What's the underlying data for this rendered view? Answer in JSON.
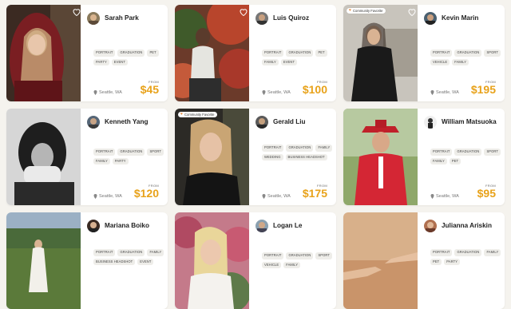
{
  "colors": {
    "price": "#e8a21a",
    "badge_heart": "#e88a3a",
    "background": "#f5f3ee"
  },
  "labels": {
    "from": "FROM"
  },
  "cards": [
    {
      "name": "Sarah Park",
      "tags": [
        "PORTRAIT",
        "GRADUATION",
        "PET",
        "PARTY",
        "EVENT"
      ],
      "location": "Seattle, WA",
      "price": "$45",
      "favorite_icon": "heart-outline-icon"
    },
    {
      "name": "Luis Quiroz",
      "tags": [
        "PORTRAIT",
        "GRADUATION",
        "PET",
        "FAMILY",
        "EVENT"
      ],
      "location": "Seattle, WA",
      "price": "$100",
      "favorite_icon": "heart-outline-icon"
    },
    {
      "name": "Kevin Marin",
      "badge": "Community Favorite",
      "tags": [
        "PORTRAIT",
        "GRADUATION",
        "SPORT",
        "VEHICLE",
        "FAMILY"
      ],
      "location": "Seattle, WA",
      "price": "$195",
      "favorite_icon": "heart-outline-icon"
    },
    {
      "name": "Kenneth Yang",
      "tags": [
        "PORTRAIT",
        "GRADUATION",
        "SPORT",
        "FAMILY",
        "PARTY"
      ],
      "location": "Seattle, WA",
      "price": "$120"
    },
    {
      "name": "Gerald Liu",
      "badge": "Community Favorite",
      "tags": [
        "PORTRAIT",
        "GRADUATION",
        "FAMILY",
        "WEDDING",
        "BUSINESS HEADSHOT"
      ],
      "location": "Seattle, WA",
      "price": "$175"
    },
    {
      "name": "William Matsuoka",
      "tags": [
        "PORTRAIT",
        "GRADUATION",
        "SPORT",
        "FAMILY",
        "PET"
      ],
      "location": "Seattle, WA",
      "price": "$95"
    },
    {
      "name": "Mariana Boiko",
      "tags": [
        "PORTRAIT",
        "GRADUATION",
        "FAMILY",
        "BUSINESS HEADSHOT",
        "EVENT"
      ]
    },
    {
      "name": "Logan Le",
      "tags": [
        "PORTRAIT",
        "GRADUATION",
        "SPORT",
        "VEHICLE",
        "FAMILY"
      ]
    },
    {
      "name": "Julianna Ariskin",
      "tags": [
        "PORTRAIT",
        "GRADUATION",
        "FAMILY",
        "PET",
        "PARTY"
      ]
    }
  ]
}
